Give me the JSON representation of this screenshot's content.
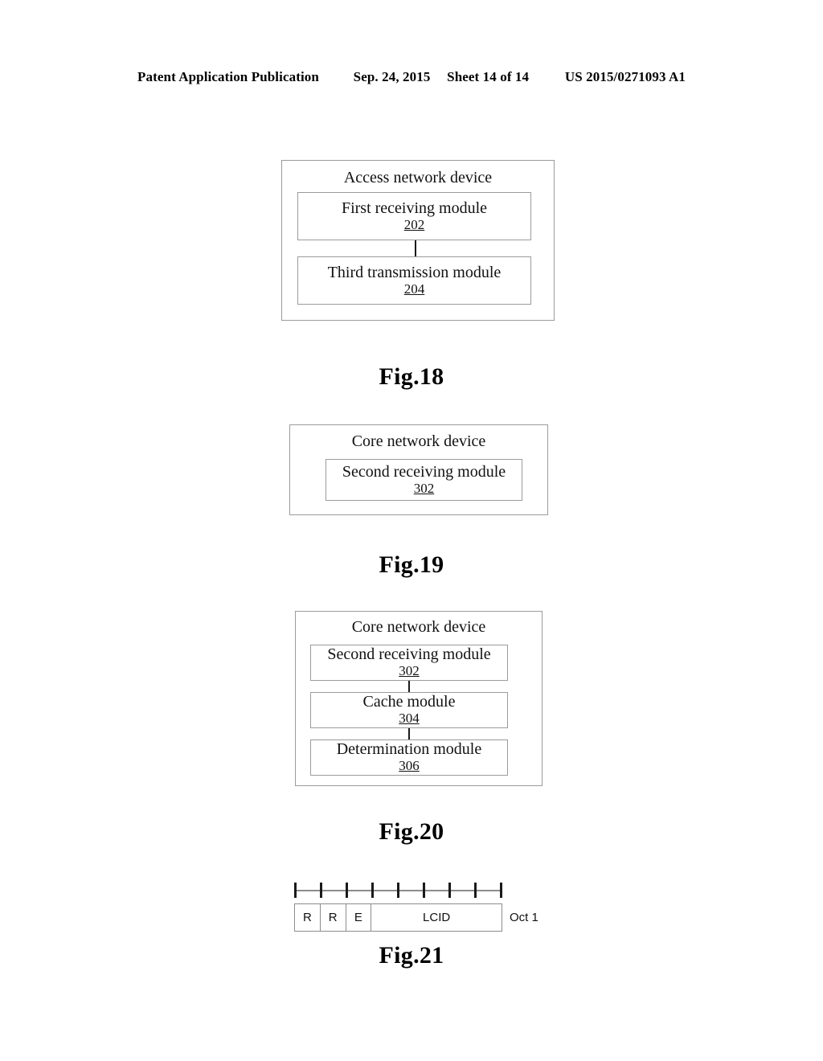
{
  "header": {
    "publication": "Patent Application Publication",
    "date": "Sep. 24, 2015",
    "sheet": "Sheet 14 of 14",
    "patent_number": "US 2015/0271093 A1"
  },
  "figures": [
    {
      "id": "fig18",
      "caption": "Fig.18",
      "container_label": "Access network device",
      "modules": [
        {
          "name": "First receiving module",
          "number": "202"
        },
        {
          "name": "Third transmission module",
          "number": "204"
        }
      ]
    },
    {
      "id": "fig19",
      "caption": "Fig.19",
      "container_label": "Core network device",
      "modules": [
        {
          "name": "Second receiving module",
          "number": "302"
        }
      ]
    },
    {
      "id": "fig20",
      "caption": "Fig.20",
      "container_label": "Core network device",
      "modules": [
        {
          "name": "Second receiving module",
          "number": "302"
        },
        {
          "name": "Cache module",
          "number": "304"
        },
        {
          "name": "Determination module",
          "number": "306"
        }
      ]
    },
    {
      "id": "fig21",
      "caption": "Fig.21",
      "bit_field": {
        "tick_count": 9,
        "cells": [
          {
            "label": "R",
            "bits": 1
          },
          {
            "label": "R",
            "bits": 1
          },
          {
            "label": "E",
            "bits": 1
          },
          {
            "label": "LCID",
            "bits": 5
          }
        ],
        "octet_label": "Oct 1"
      }
    }
  ],
  "colors": {
    "box_border": "#9b9b9b",
    "bit_border": "#8c8c8c",
    "connector": "#1a1a1a",
    "text": "#111111",
    "background": "#ffffff"
  }
}
